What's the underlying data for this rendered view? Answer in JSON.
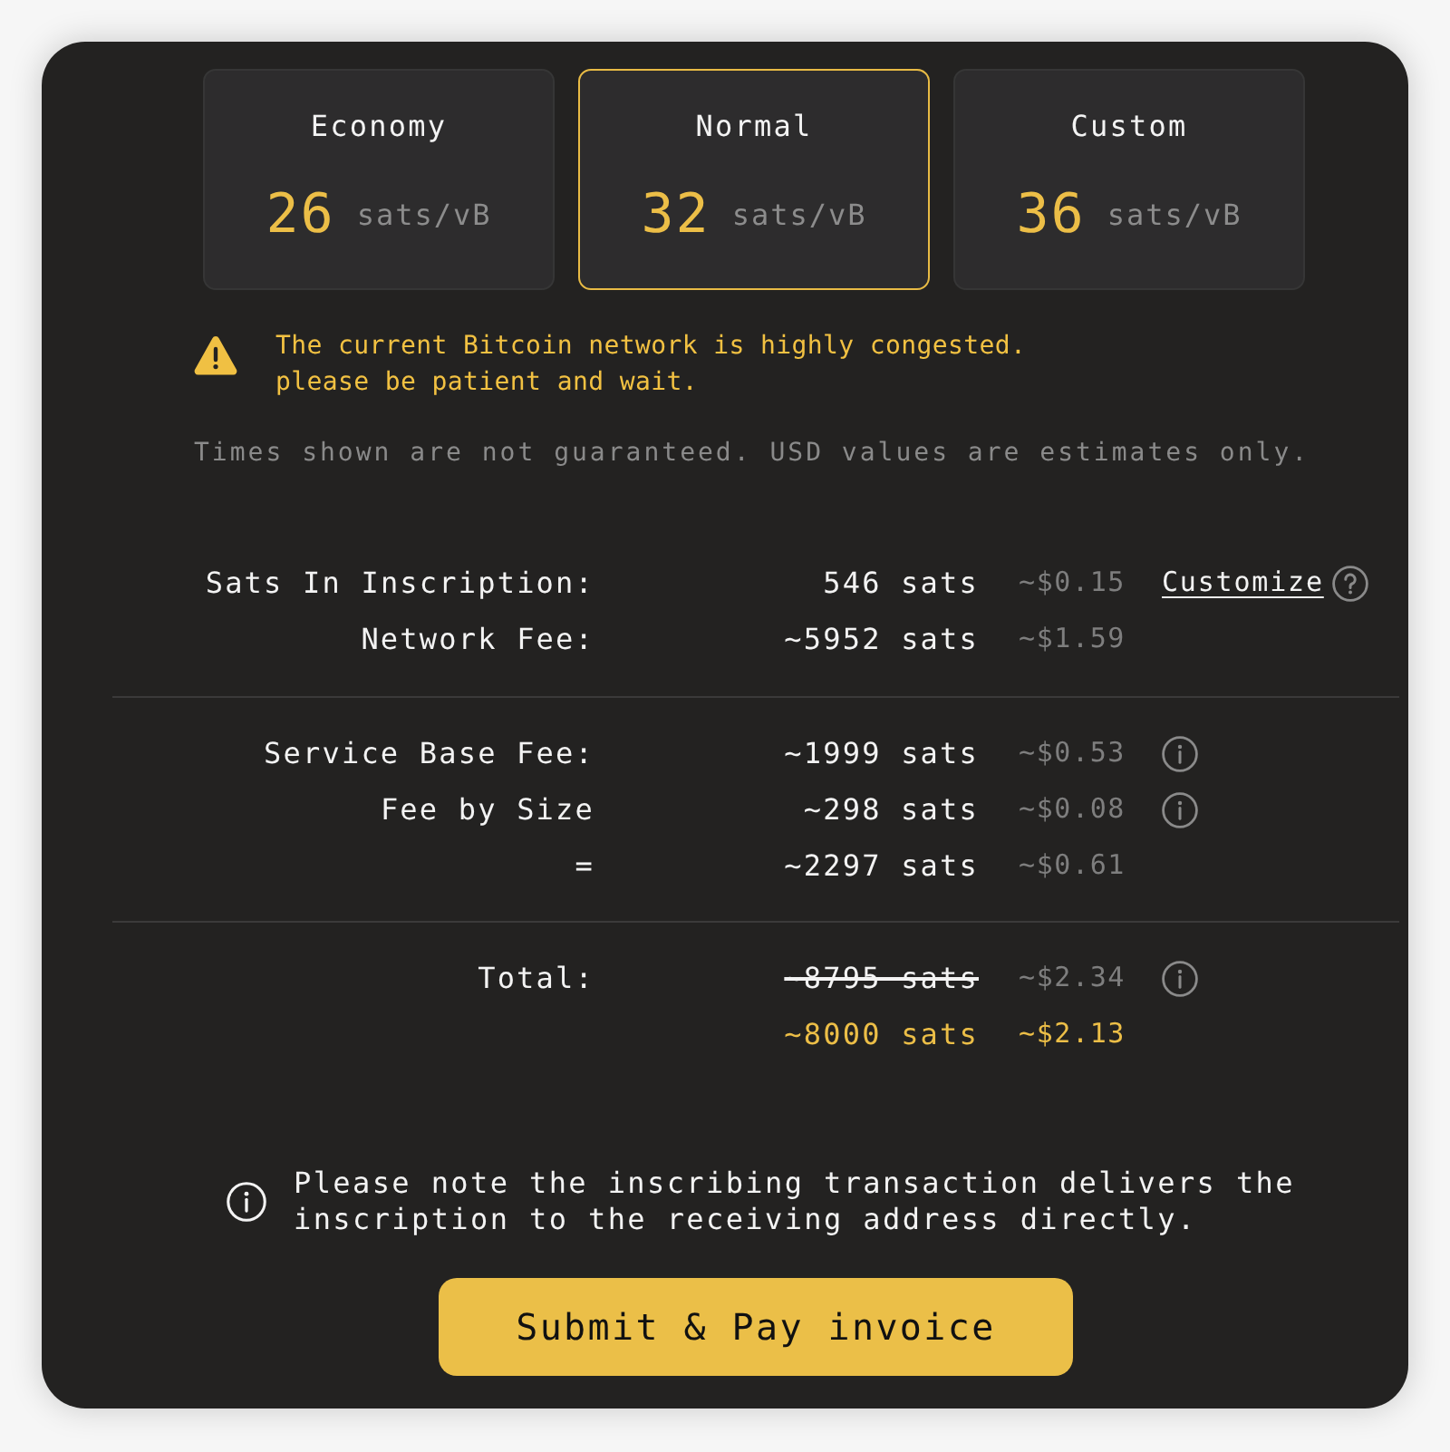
{
  "fee_options": [
    {
      "label": "Economy",
      "rate": "26",
      "unit": "sats/vB",
      "selected": false
    },
    {
      "label": "Normal",
      "rate": "32",
      "unit": "sats/vB",
      "selected": true
    },
    {
      "label": "Custom",
      "rate": "36",
      "unit": "sats/vB",
      "selected": false
    }
  ],
  "warning": {
    "lines": [
      "The current Bitcoin network is highly congested.",
      "please be patient and wait."
    ]
  },
  "disclaimer": "Times shown are not guaranteed. USD values are estimates only.",
  "fee_groups": [
    {
      "rows": [
        {
          "label": "Sats In Inscription:",
          "amount": "546 sats",
          "usd": "~$0.15",
          "link": "Customize",
          "info": false,
          "struck": false,
          "highlighted": false
        },
        {
          "label": "Network Fee:",
          "amount": "~5952 sats",
          "usd": "~$1.59",
          "info": false,
          "struck": false,
          "highlighted": false
        }
      ]
    },
    {
      "rows": [
        {
          "label": "Service Base Fee:",
          "amount": "~1999 sats",
          "usd": "~$0.53",
          "info": true,
          "struck": false,
          "highlighted": false
        },
        {
          "label": "Fee by Size",
          "amount": "~298 sats",
          "usd": "~$0.08",
          "info": true,
          "struck": false,
          "highlighted": false
        },
        {
          "label": "=",
          "amount": "~2297 sats",
          "usd": "~$0.61",
          "info": false,
          "struck": false,
          "highlighted": false
        }
      ]
    },
    {
      "rows": [
        {
          "label": "Total:",
          "amount": "~8795 sats",
          "usd": "~$2.34",
          "info": true,
          "struck": true,
          "highlighted": false
        },
        {
          "amount": "~8000 sats",
          "usd": "~$2.13",
          "info": false,
          "struck": false,
          "highlighted": true
        }
      ]
    }
  ],
  "note": "Please note the inscribing transaction delivers the inscription to the receiving address directly.",
  "submit_button": "Submit & Pay invoice"
}
